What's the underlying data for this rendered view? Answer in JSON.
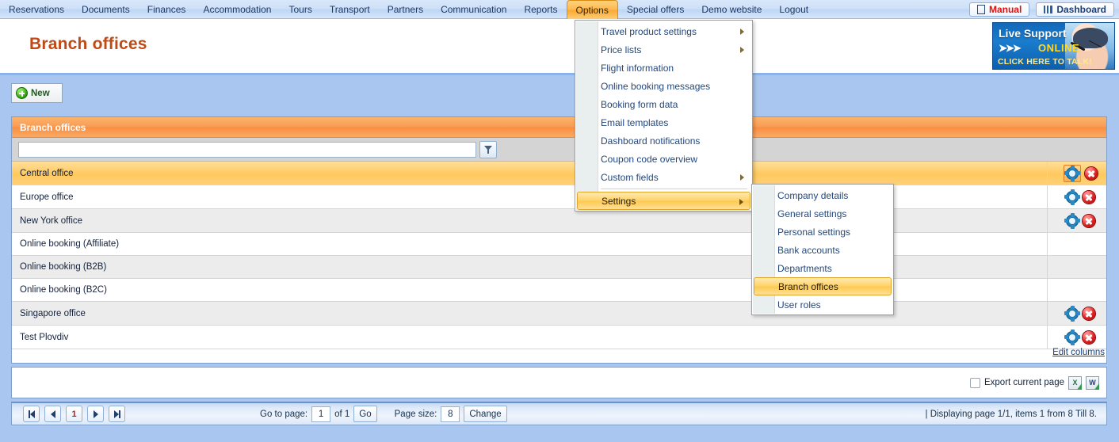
{
  "menubar": {
    "items": [
      {
        "label": "Reservations",
        "active": false
      },
      {
        "label": "Documents",
        "active": false
      },
      {
        "label": "Finances",
        "active": false
      },
      {
        "label": "Accommodation",
        "active": false
      },
      {
        "label": "Tours",
        "active": false
      },
      {
        "label": "Transport",
        "active": false
      },
      {
        "label": "Partners",
        "active": false
      },
      {
        "label": "Communication",
        "active": false
      },
      {
        "label": "Reports",
        "active": false
      },
      {
        "label": "Options",
        "active": true
      },
      {
        "label": "Special offers",
        "active": false
      },
      {
        "label": "Demo website",
        "active": false
      },
      {
        "label": "Logout",
        "active": false
      }
    ],
    "manual_label": "Manual",
    "dashboard_label": "Dashboard",
    "manual_color": "#e01010",
    "dashboard_color": "#1c3f73",
    "active_color": "#fba832"
  },
  "header": {
    "title": "Branch offices",
    "title_color": "#c04a15"
  },
  "live_support": {
    "title": "Live Support",
    "arrows": "➤➤➤",
    "status": "ONLINE",
    "cta": "CLICK HERE TO TALK!",
    "status_color": "#ffd92e"
  },
  "toolbar": {
    "new_label": "New"
  },
  "dropdown": {
    "items": [
      {
        "label": "Travel product settings",
        "submenu": true,
        "selected": false
      },
      {
        "label": "Price lists",
        "submenu": true,
        "selected": false
      },
      {
        "label": "Flight information",
        "submenu": false,
        "selected": false
      },
      {
        "label": "Online booking messages",
        "submenu": false,
        "selected": false
      },
      {
        "label": "Booking form data",
        "submenu": false,
        "selected": false
      },
      {
        "label": "Email templates",
        "submenu": false,
        "selected": false
      },
      {
        "label": "Dashboard notifications",
        "submenu": false,
        "selected": false
      },
      {
        "label": "Coupon code overview",
        "submenu": false,
        "selected": false
      },
      {
        "label": "Custom fields",
        "submenu": true,
        "selected": false
      },
      {
        "label": "Settings",
        "submenu": true,
        "selected": true
      }
    ]
  },
  "submenu": {
    "items": [
      {
        "label": "Company details",
        "selected": false
      },
      {
        "label": "General settings",
        "selected": false
      },
      {
        "label": "Personal settings",
        "selected": false
      },
      {
        "label": "Bank accounts",
        "selected": false
      },
      {
        "label": "Departments",
        "selected": false
      },
      {
        "label": "Branch offices",
        "selected": true
      },
      {
        "label": "User roles",
        "selected": false
      }
    ]
  },
  "grid": {
    "caption": "Branch offices",
    "filter_value": "",
    "filter_placeholder": "",
    "rows": [
      {
        "name": "Central office",
        "has_actions": true,
        "highlighted": true,
        "gear_hover": true
      },
      {
        "name": "Europe office",
        "has_actions": true,
        "highlighted": false,
        "gear_hover": false
      },
      {
        "name": "New York office",
        "has_actions": true,
        "highlighted": false,
        "gear_hover": false
      },
      {
        "name": "Online booking (Affiliate)",
        "has_actions": false,
        "highlighted": false,
        "gear_hover": false
      },
      {
        "name": "Online booking (B2B)",
        "has_actions": false,
        "highlighted": false,
        "gear_hover": false
      },
      {
        "name": "Online booking (B2C)",
        "has_actions": false,
        "highlighted": false,
        "gear_hover": false
      },
      {
        "name": "Singapore office",
        "has_actions": true,
        "highlighted": false,
        "gear_hover": false
      },
      {
        "name": "Test Plovdiv",
        "has_actions": true,
        "highlighted": false,
        "gear_hover": false
      }
    ],
    "edit_columns_label": "Edit columns"
  },
  "export": {
    "label": "Export current page",
    "checked": false,
    "excel_glyph": "X",
    "word_glyph": "W"
  },
  "pager": {
    "current_page": "1",
    "goto_label": "Go to page:",
    "goto_value": "1",
    "of_label": "of 1",
    "go_label": "Go",
    "pagesize_label": "Page size:",
    "pagesize_value": "8",
    "change_label": "Change",
    "status": "| Displaying page 1/1,  items  1  from  8  Till 8."
  }
}
